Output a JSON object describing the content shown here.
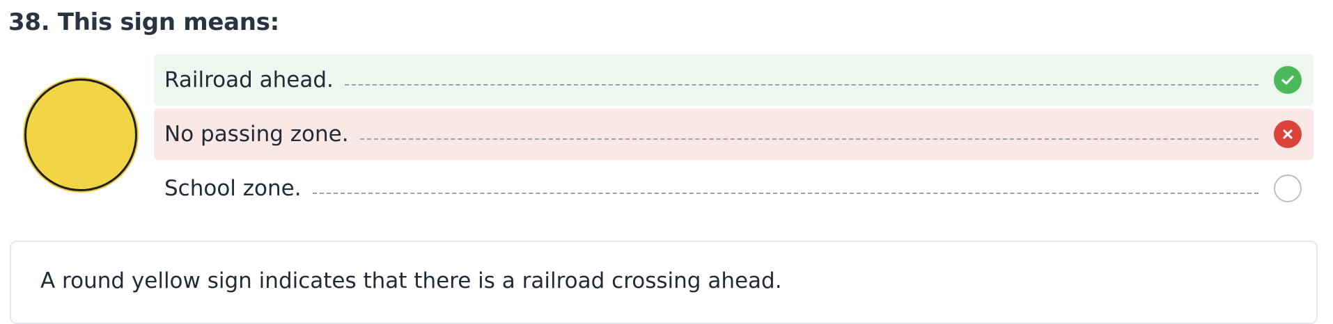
{
  "question": {
    "title": "38. This sign means:",
    "sign_icon": "round-yellow-railroad-sign"
  },
  "options": [
    {
      "label": "Railroad ahead.",
      "state": "correct",
      "icon": "check-icon"
    },
    {
      "label": "No passing zone.",
      "state": "incorrect",
      "icon": "close-icon"
    },
    {
      "label": "School zone.",
      "state": "unselected",
      "icon": "empty-radio-icon"
    }
  ],
  "explanation": {
    "text": "A round yellow sign indicates that there is a railroad crossing ahead."
  },
  "colors": {
    "correct_bg": "#edf7ef",
    "incorrect_bg": "#fae8e7",
    "correct_icon": "#4bb85a",
    "incorrect_icon": "#d9433a",
    "sign_fill": "#f2d545"
  }
}
